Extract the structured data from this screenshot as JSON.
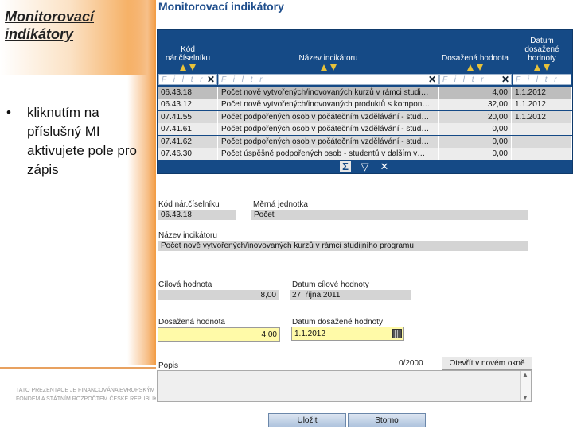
{
  "slide": {
    "title": "Monitorovací indikátory",
    "bullet": "kliknutím na příslušný MI aktivujete pole pro zápis",
    "footer_line1": "TATO PREZENTACE JE FINANCOVÁNA EVROPSKÝM SOCIÁLNÍM",
    "footer_line2": "FONDEM A STÁTNÍM ROZPOČTEM ČESKÉ REPUBLIKY"
  },
  "panel": {
    "title": "Monitorovací indikátory"
  },
  "grid": {
    "columns": [
      {
        "key": "code",
        "label": "Kód nár.číselníku"
      },
      {
        "key": "name",
        "label": "Název incikátoru"
      },
      {
        "key": "achieved",
        "label": "Dosažená hodnota"
      },
      {
        "key": "date",
        "label": "Datum dosažené hodnoty"
      }
    ],
    "filter_placeholder": "F i l t r",
    "rows": [
      {
        "code": "06.43.18",
        "name": "Počet nově vytvořených/inovovaných kurzů v rámci studi…",
        "achieved": "4,00",
        "date": "1.1.2012",
        "selected": true
      },
      {
        "code": "06.43.12",
        "name": "Počet nově vytvořených/inovovaných produktů s kompon…",
        "achieved": "32,00",
        "date": "1.1.2012",
        "selected": false
      },
      {
        "code": "07.41.55",
        "name": "Počet podpořených osob v počátečním vzdělávání - stud…",
        "achieved": "20,00",
        "date": "1.1.2012",
        "selected": false
      },
      {
        "code": "07.41.61",
        "name": "Počet podpořených osob v počátečním vzdělávání - stud…",
        "achieved": "0,00",
        "date": "",
        "selected": false
      },
      {
        "code": "07.41.62",
        "name": "Počet podpořených osob v počátečním vzdělávání - stud…",
        "achieved": "0,00",
        "date": "",
        "selected": false
      },
      {
        "code": "07.46.30",
        "name": "Počet úspěšně podpořených osob - studentů v dalším v…",
        "achieved": "0,00",
        "date": "",
        "selected": false
      }
    ]
  },
  "detail": {
    "code_label": "Kód nár.číselníku",
    "code_value": "06.43.18",
    "unit_label": "Měrná jednotka",
    "unit_value": "Počet",
    "name_label": "Název incikátoru",
    "name_value": "Počet nově vytvořených/inovovaných kurzů v rámci studijního programu",
    "target_label": "Cílová hodnota",
    "target_value": "8,00",
    "target_date_label": "Datum cílové hodnoty",
    "target_date_value": "27. října 2011",
    "achieved_label": "Dosažená hodnota",
    "achieved_value": "4,00",
    "achieved_date_label": "Datum dosažené hodnoty",
    "achieved_date_value": "1.1.2012",
    "popis_label": "Popis",
    "counter": "0/2000",
    "open_new_window": "Otevřít v novém okně"
  },
  "buttons": {
    "save": "Uložit",
    "cancel": "Storno"
  }
}
